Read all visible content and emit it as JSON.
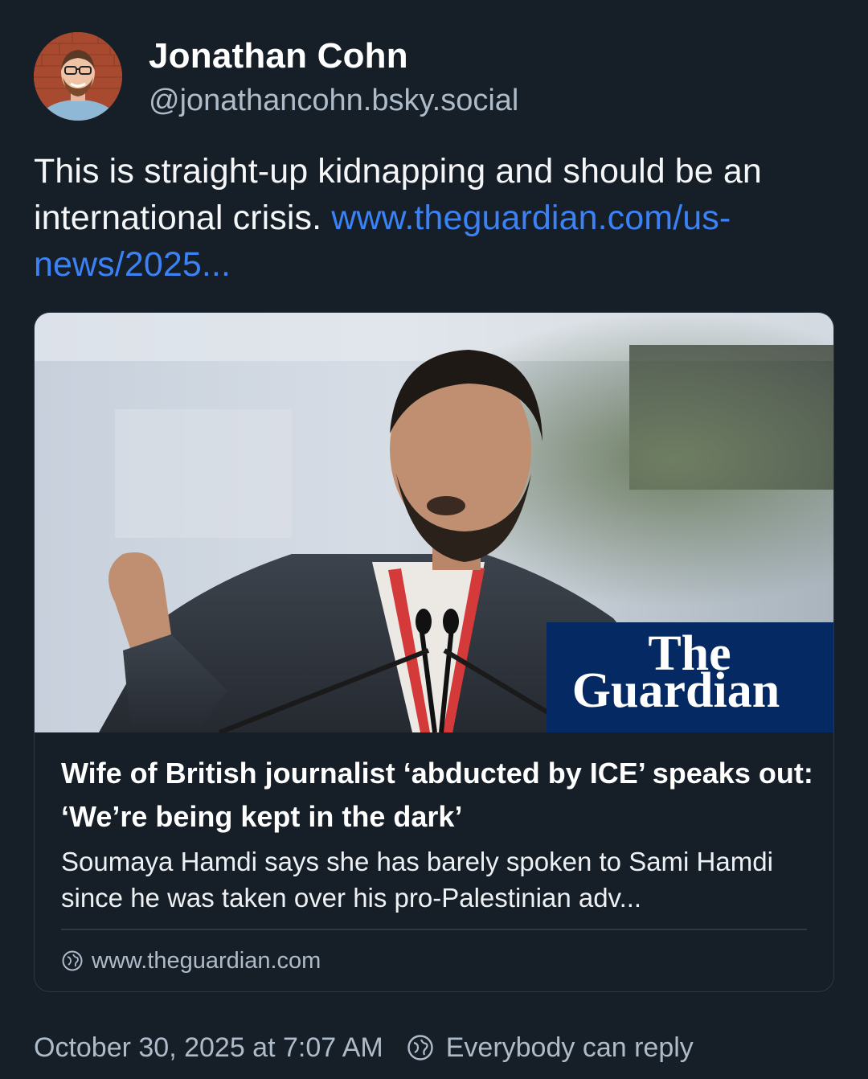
{
  "author": {
    "display_name": "Jonathan Cohn",
    "handle": "@jonathancohn.bsky.social",
    "avatar_icon": "profile-photo"
  },
  "post": {
    "text": "This is straight-up kidnapping and should be an international crisis. ",
    "link_text": "www.theguardian.com/us-news/2025..."
  },
  "card": {
    "image_logo_line1": "The",
    "image_logo_line2": "Guardian",
    "title": "Wife of British journalist ‘abducted by ICE’ speaks out: ‘We’re being kept in the dark’",
    "description": "Soumaya Hamdi says she has barely spoken to Sami Hamdi since he was taken over his pro-Palestinian adv...",
    "domain": "www.theguardian.com",
    "domain_icon": "globe-icon",
    "logo_bg_color": "#052962"
  },
  "footer": {
    "timestamp": "October 30, 2025 at 7:07 AM",
    "reply_setting": "Everybody can reply",
    "reply_icon": "globe-icon"
  },
  "colors": {
    "background": "#161e27",
    "link": "#3b82f6",
    "muted_text": "#aebbc9"
  }
}
